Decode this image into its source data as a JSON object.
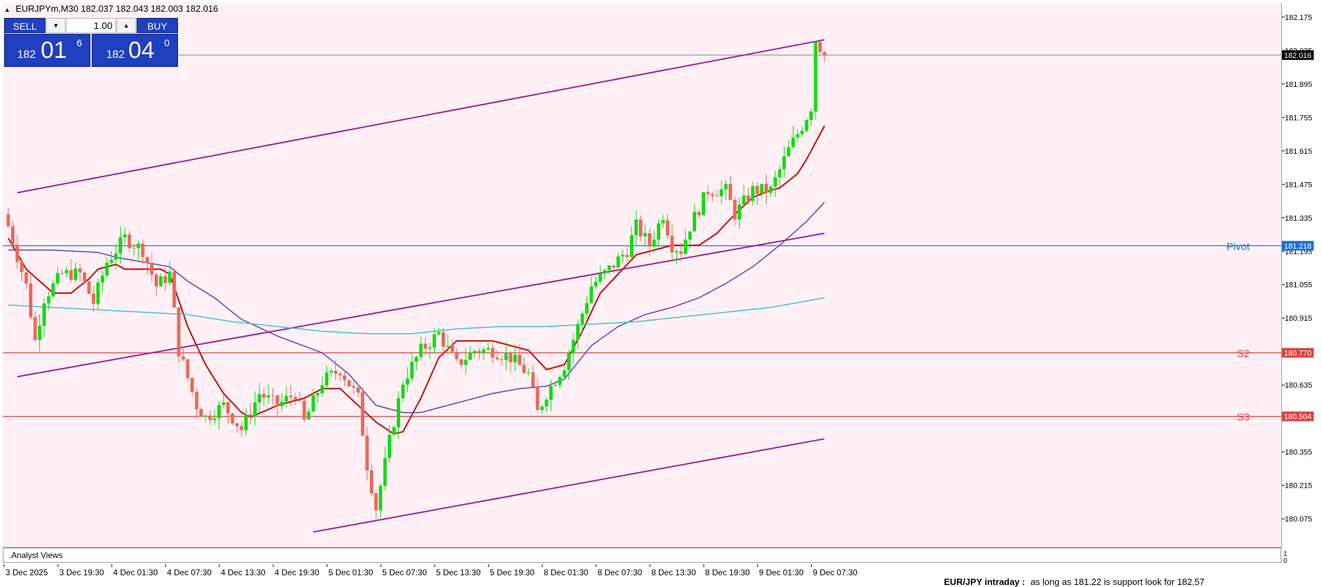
{
  "header": {
    "symbol": "EURJPYm,M30",
    "ohlc": "182.037 182.043 182.003 182.016"
  },
  "trade_panel": {
    "sell_label": "SELL",
    "buy_label": "BUY",
    "lot_value": "1.00",
    "sell_price_small": "182",
    "sell_price_big": "01",
    "sell_price_sup": "6",
    "buy_price_small": "182",
    "buy_price_big": "04",
    "buy_price_sup": "0"
  },
  "subwindow": {
    "label": ".Analyst Views",
    "caption_bold": "EUR/JPY intraday :",
    "caption_text": "as long as 181.22 is support look for 182.57",
    "scale_top": "1",
    "scale_bottom": "0"
  },
  "colors": {
    "background": "#fff0f5",
    "bull_candle": "#12dd12",
    "bear_candle": "#ea6a5c",
    "ma_fast": "#cc0000",
    "ma_mid": "#5a3fbf",
    "ma_slow": "#40c4c0",
    "channel": "#a020a0",
    "pivot_line": "#1a6fd6",
    "support_line": "#e04040",
    "current_price_line": "#808080"
  },
  "chart_data": {
    "type": "candlestick",
    "symbol": "EURJPYm",
    "timeframe": "M30",
    "ylim": [
      180.015,
      182.235
    ],
    "y_ticks": [
      "182.175",
      "182.035",
      "181.895",
      "181.755",
      "181.615",
      "181.475",
      "181.335",
      "181.195",
      "181.055",
      "180.915",
      "180.775",
      "180.635",
      "180.495",
      "180.355",
      "180.215",
      "180.075"
    ],
    "x_ticks": [
      "3 Dec 2025",
      "3 Dec 19:30",
      "4 Dec 01:30",
      "4 Dec 07:30",
      "4 Dec 13:30",
      "4 Dec 19:30",
      "5 Dec 01:30",
      "5 Dec 07:30",
      "5 Dec 13:30",
      "5 Dec 19:30",
      "8 Dec 01:30",
      "8 Dec 07:30",
      "8 Dec 13:30",
      "8 Dec 19:30",
      "9 Dec 01:30",
      "9 Dec 07:30"
    ],
    "x_tick_bars": [
      0,
      12,
      24,
      36,
      48,
      60,
      72,
      84,
      96,
      108,
      120,
      132,
      144,
      156,
      168,
      180
    ],
    "close_anchors": [
      [
        0,
        181.3
      ],
      [
        4,
        181.05
      ],
      [
        6,
        180.82
      ],
      [
        8,
        181.0
      ],
      [
        12,
        181.1
      ],
      [
        16,
        181.1
      ],
      [
        19,
        180.98
      ],
      [
        22,
        181.15
      ],
      [
        26,
        181.25
      ],
      [
        30,
        181.2
      ],
      [
        33,
        181.05
      ],
      [
        36,
        181.1
      ],
      [
        38,
        180.78
      ],
      [
        42,
        180.55
      ],
      [
        44,
        180.5
      ],
      [
        48,
        180.55
      ],
      [
        52,
        180.45
      ],
      [
        56,
        180.6
      ],
      [
        60,
        180.55
      ],
      [
        64,
        180.6
      ],
      [
        66,
        180.48
      ],
      [
        70,
        180.65
      ],
      [
        74,
        180.7
      ],
      [
        78,
        180.58
      ],
      [
        80,
        180.3
      ],
      [
        82,
        180.12
      ],
      [
        85,
        180.4
      ],
      [
        88,
        180.65
      ],
      [
        92,
        180.78
      ],
      [
        96,
        180.85
      ],
      [
        100,
        180.72
      ],
      [
        104,
        180.78
      ],
      [
        108,
        180.78
      ],
      [
        112,
        180.75
      ],
      [
        116,
        180.68
      ],
      [
        118,
        180.52
      ],
      [
        120,
        180.6
      ],
      [
        124,
        180.72
      ],
      [
        127,
        180.88
      ],
      [
        130,
        181.05
      ],
      [
        134,
        181.12
      ],
      [
        138,
        181.2
      ],
      [
        140,
        181.3
      ],
      [
        143,
        181.22
      ],
      [
        146,
        181.35
      ],
      [
        148,
        181.22
      ],
      [
        150,
        181.2
      ],
      [
        152,
        181.3
      ],
      [
        156,
        181.45
      ],
      [
        160,
        181.45
      ],
      [
        162,
        181.35
      ],
      [
        166,
        181.45
      ],
      [
        170,
        181.45
      ],
      [
        174,
        181.62
      ],
      [
        177,
        181.72
      ],
      [
        179,
        181.8
      ],
      [
        180,
        182.08
      ],
      [
        182,
        182.016
      ]
    ],
    "moving_averages": [
      {
        "values": [
          [
            0,
            181.25
          ],
          [
            4,
            181.12
          ],
          [
            10,
            181.02
          ],
          [
            14,
            181.02
          ],
          [
            18,
            181.08
          ],
          [
            20,
            181.12
          ],
          [
            24,
            181.14
          ],
          [
            26,
            181.12
          ],
          [
            34,
            181.12
          ],
          [
            36,
            181.1
          ],
          [
            40,
            180.88
          ],
          [
            44,
            180.72
          ],
          [
            48,
            180.6
          ],
          [
            52,
            180.52
          ],
          [
            54,
            180.5
          ],
          [
            60,
            180.55
          ],
          [
            66,
            180.58
          ],
          [
            70,
            180.62
          ],
          [
            74,
            180.62
          ],
          [
            78,
            180.55
          ],
          [
            82,
            180.48
          ],
          [
            86,
            180.43
          ],
          [
            88,
            180.44
          ],
          [
            92,
            180.58
          ],
          [
            96,
            180.75
          ],
          [
            100,
            180.82
          ],
          [
            104,
            180.82
          ],
          [
            108,
            180.82
          ],
          [
            112,
            180.8
          ],
          [
            116,
            180.78
          ],
          [
            120,
            180.7
          ],
          [
            124,
            180.72
          ],
          [
            128,
            180.86
          ],
          [
            132,
            181.02
          ],
          [
            136,
            181.1
          ],
          [
            140,
            181.18
          ],
          [
            144,
            181.2
          ],
          [
            148,
            181.22
          ],
          [
            150,
            181.22
          ],
          [
            154,
            181.22
          ],
          [
            158,
            181.27
          ],
          [
            162,
            181.35
          ],
          [
            166,
            181.42
          ],
          [
            170,
            181.45
          ],
          [
            172,
            181.46
          ],
          [
            176,
            181.52
          ],
          [
            178,
            181.58
          ],
          [
            180,
            181.65
          ],
          [
            182,
            181.72
          ]
        ]
      },
      {
        "values": [
          [
            0,
            181.2
          ],
          [
            10,
            181.2
          ],
          [
            20,
            181.19
          ],
          [
            24,
            181.17
          ],
          [
            30,
            181.15
          ],
          [
            36,
            181.13
          ],
          [
            40,
            181.07
          ],
          [
            46,
            181.0
          ],
          [
            52,
            180.91
          ],
          [
            60,
            180.84
          ],
          [
            70,
            180.77
          ],
          [
            76,
            180.68
          ],
          [
            82,
            180.55
          ],
          [
            88,
            180.52
          ],
          [
            92,
            180.52
          ],
          [
            100,
            180.56
          ],
          [
            108,
            180.6
          ],
          [
            114,
            180.62
          ],
          [
            120,
            180.63
          ],
          [
            124,
            180.66
          ],
          [
            130,
            180.8
          ],
          [
            136,
            180.88
          ],
          [
            142,
            180.93
          ],
          [
            148,
            180.96
          ],
          [
            154,
            181.0
          ],
          [
            160,
            181.06
          ],
          [
            166,
            181.13
          ],
          [
            172,
            181.22
          ],
          [
            178,
            181.32
          ],
          [
            182,
            181.4
          ]
        ]
      },
      {
        "values": [
          [
            0,
            180.97
          ],
          [
            10,
            180.96
          ],
          [
            20,
            180.95
          ],
          [
            30,
            180.94
          ],
          [
            40,
            180.93
          ],
          [
            50,
            180.9
          ],
          [
            60,
            180.88
          ],
          [
            70,
            180.86
          ],
          [
            80,
            180.85
          ],
          [
            90,
            180.85
          ],
          [
            100,
            180.87
          ],
          [
            110,
            180.88
          ],
          [
            120,
            180.88
          ],
          [
            130,
            180.89
          ],
          [
            140,
            180.9
          ],
          [
            150,
            180.92
          ],
          [
            160,
            180.94
          ],
          [
            170,
            180.96
          ],
          [
            182,
            181.0
          ]
        ]
      }
    ],
    "channel_lines": [
      {
        "from": [
          2,
          181.44
        ],
        "to": [
          182,
          182.08
        ]
      },
      {
        "from": [
          2,
          180.67
        ],
        "to": [
          182,
          181.27
        ]
      },
      {
        "from": [
          68,
          180.02
        ],
        "to": [
          182,
          180.41
        ]
      }
    ],
    "levels": [
      {
        "name": "Pivot",
        "value": 181.218,
        "label": "181.218"
      },
      {
        "name": "S2",
        "value": 180.77,
        "label": "180.770"
      },
      {
        "name": "S3",
        "value": 180.504,
        "label": "180.504"
      }
    ],
    "current_price": {
      "value": 182.016,
      "label": "182.016"
    }
  }
}
